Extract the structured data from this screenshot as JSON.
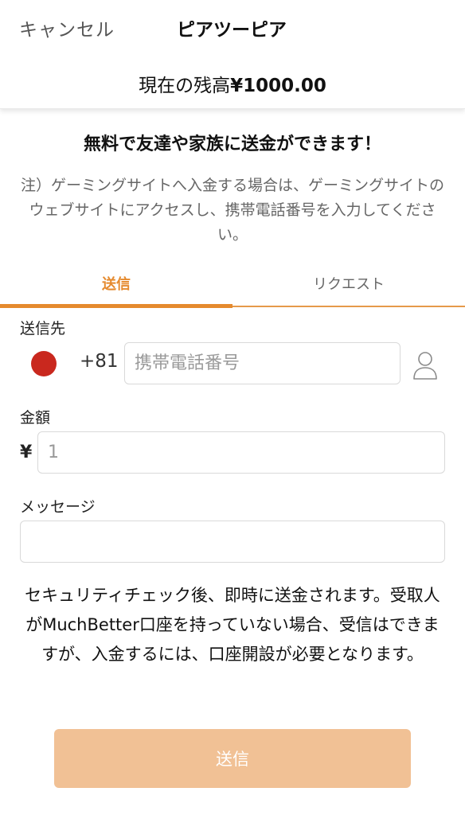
{
  "header": {
    "cancel_label": "キャンセル",
    "title": "ピアツーピア",
    "balance_label": "現在の残高",
    "balance_amount": "¥1000.00"
  },
  "promo": {
    "title": "無料で友達や家族に送金ができます！",
    "note": "注）ゲーミングサイトへ入金する場合は、ゲーミングサイトのウェブサイトにアクセスし、携帯電話番号を入力してください。"
  },
  "tabs": [
    {
      "label": "送信",
      "active": true
    },
    {
      "label": "リクエスト",
      "active": false
    }
  ],
  "form": {
    "recipient_label": "送信先",
    "country_code": "+81",
    "country_flag_color": "#c9281e",
    "phone_placeholder": "携帯電話番号",
    "contact_icon": "person-contact-icon",
    "amount_label": "金額",
    "currency_symbol": "¥",
    "amount_placeholder": "1",
    "message_label": "メッセージ",
    "message_placeholder": ""
  },
  "info_text": "セキュリティチェック後、即時に送金されます。受取人がMuchBetter口座を持っていない場合、受信はできますが、入金するには、口座開設が必要となります。",
  "send_button_label": "送信",
  "colors": {
    "accent": "#e58a2e",
    "button_disabled": "#f1c195"
  }
}
